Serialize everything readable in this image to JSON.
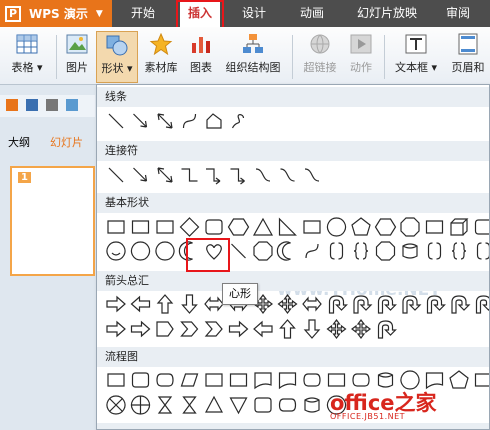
{
  "app": {
    "logo_letter": "P",
    "name": "WPS 演示"
  },
  "menu": {
    "tabs": [
      "开始",
      "插入",
      "设计",
      "动画",
      "幻灯片放映",
      "审阅"
    ]
  },
  "ribbon": {
    "table": "表格",
    "picture": "图片",
    "shape": "形状",
    "material": "素材库",
    "chart": "图表",
    "org": "组织结构图",
    "hyperlink": "超链接",
    "action": "动作",
    "textbox": "文本框",
    "header": "页眉和"
  },
  "panel": {
    "outline": "大纲",
    "slides": "幻灯片",
    "slide_number": "1"
  },
  "dropdown": {
    "sections": [
      "线条",
      "连接符",
      "基本形状",
      "箭头总汇",
      "流程图"
    ],
    "tooltip": "心形",
    "watermark": "www.YHome.NET"
  },
  "brand": {
    "main": "office之家",
    "sub": "OFFICE.JB51.NET"
  },
  "colors": {
    "accent": "#e8741a",
    "highlight": "#e8161a",
    "menubar": "#4d4d4d"
  }
}
